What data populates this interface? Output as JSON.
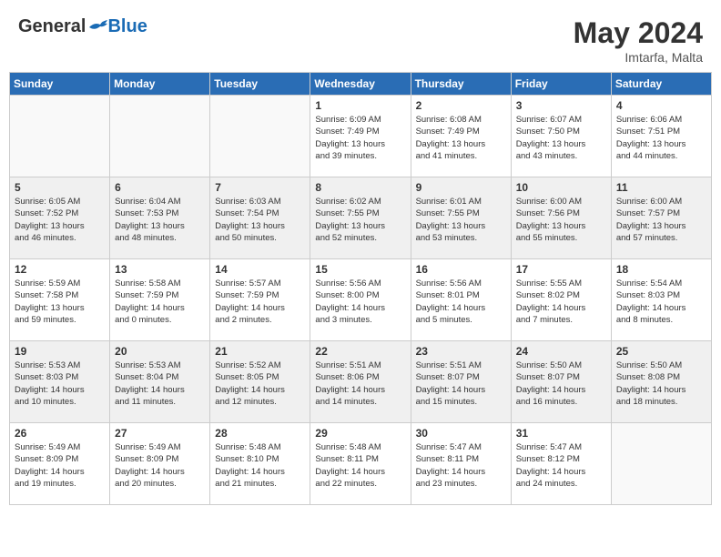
{
  "header": {
    "logo_general": "General",
    "logo_blue": "Blue",
    "month_year": "May 2024",
    "location": "Imtarfa, Malta"
  },
  "days_of_week": [
    "Sunday",
    "Monday",
    "Tuesday",
    "Wednesday",
    "Thursday",
    "Friday",
    "Saturday"
  ],
  "weeks": [
    [
      {
        "day": "",
        "content": ""
      },
      {
        "day": "",
        "content": ""
      },
      {
        "day": "",
        "content": ""
      },
      {
        "day": "1",
        "content": "Sunrise: 6:09 AM\nSunset: 7:49 PM\nDaylight: 13 hours\nand 39 minutes."
      },
      {
        "day": "2",
        "content": "Sunrise: 6:08 AM\nSunset: 7:49 PM\nDaylight: 13 hours\nand 41 minutes."
      },
      {
        "day": "3",
        "content": "Sunrise: 6:07 AM\nSunset: 7:50 PM\nDaylight: 13 hours\nand 43 minutes."
      },
      {
        "day": "4",
        "content": "Sunrise: 6:06 AM\nSunset: 7:51 PM\nDaylight: 13 hours\nand 44 minutes."
      }
    ],
    [
      {
        "day": "5",
        "content": "Sunrise: 6:05 AM\nSunset: 7:52 PM\nDaylight: 13 hours\nand 46 minutes."
      },
      {
        "day": "6",
        "content": "Sunrise: 6:04 AM\nSunset: 7:53 PM\nDaylight: 13 hours\nand 48 minutes."
      },
      {
        "day": "7",
        "content": "Sunrise: 6:03 AM\nSunset: 7:54 PM\nDaylight: 13 hours\nand 50 minutes."
      },
      {
        "day": "8",
        "content": "Sunrise: 6:02 AM\nSunset: 7:55 PM\nDaylight: 13 hours\nand 52 minutes."
      },
      {
        "day": "9",
        "content": "Sunrise: 6:01 AM\nSunset: 7:55 PM\nDaylight: 13 hours\nand 53 minutes."
      },
      {
        "day": "10",
        "content": "Sunrise: 6:00 AM\nSunset: 7:56 PM\nDaylight: 13 hours\nand 55 minutes."
      },
      {
        "day": "11",
        "content": "Sunrise: 6:00 AM\nSunset: 7:57 PM\nDaylight: 13 hours\nand 57 minutes."
      }
    ],
    [
      {
        "day": "12",
        "content": "Sunrise: 5:59 AM\nSunset: 7:58 PM\nDaylight: 13 hours\nand 59 minutes."
      },
      {
        "day": "13",
        "content": "Sunrise: 5:58 AM\nSunset: 7:59 PM\nDaylight: 14 hours\nand 0 minutes."
      },
      {
        "day": "14",
        "content": "Sunrise: 5:57 AM\nSunset: 7:59 PM\nDaylight: 14 hours\nand 2 minutes."
      },
      {
        "day": "15",
        "content": "Sunrise: 5:56 AM\nSunset: 8:00 PM\nDaylight: 14 hours\nand 3 minutes."
      },
      {
        "day": "16",
        "content": "Sunrise: 5:56 AM\nSunset: 8:01 PM\nDaylight: 14 hours\nand 5 minutes."
      },
      {
        "day": "17",
        "content": "Sunrise: 5:55 AM\nSunset: 8:02 PM\nDaylight: 14 hours\nand 7 minutes."
      },
      {
        "day": "18",
        "content": "Sunrise: 5:54 AM\nSunset: 8:03 PM\nDaylight: 14 hours\nand 8 minutes."
      }
    ],
    [
      {
        "day": "19",
        "content": "Sunrise: 5:53 AM\nSunset: 8:03 PM\nDaylight: 14 hours\nand 10 minutes."
      },
      {
        "day": "20",
        "content": "Sunrise: 5:53 AM\nSunset: 8:04 PM\nDaylight: 14 hours\nand 11 minutes."
      },
      {
        "day": "21",
        "content": "Sunrise: 5:52 AM\nSunset: 8:05 PM\nDaylight: 14 hours\nand 12 minutes."
      },
      {
        "day": "22",
        "content": "Sunrise: 5:51 AM\nSunset: 8:06 PM\nDaylight: 14 hours\nand 14 minutes."
      },
      {
        "day": "23",
        "content": "Sunrise: 5:51 AM\nSunset: 8:07 PM\nDaylight: 14 hours\nand 15 minutes."
      },
      {
        "day": "24",
        "content": "Sunrise: 5:50 AM\nSunset: 8:07 PM\nDaylight: 14 hours\nand 16 minutes."
      },
      {
        "day": "25",
        "content": "Sunrise: 5:50 AM\nSunset: 8:08 PM\nDaylight: 14 hours\nand 18 minutes."
      }
    ],
    [
      {
        "day": "26",
        "content": "Sunrise: 5:49 AM\nSunset: 8:09 PM\nDaylight: 14 hours\nand 19 minutes."
      },
      {
        "day": "27",
        "content": "Sunrise: 5:49 AM\nSunset: 8:09 PM\nDaylight: 14 hours\nand 20 minutes."
      },
      {
        "day": "28",
        "content": "Sunrise: 5:48 AM\nSunset: 8:10 PM\nDaylight: 14 hours\nand 21 minutes."
      },
      {
        "day": "29",
        "content": "Sunrise: 5:48 AM\nSunset: 8:11 PM\nDaylight: 14 hours\nand 22 minutes."
      },
      {
        "day": "30",
        "content": "Sunrise: 5:47 AM\nSunset: 8:11 PM\nDaylight: 14 hours\nand 23 minutes."
      },
      {
        "day": "31",
        "content": "Sunrise: 5:47 AM\nSunset: 8:12 PM\nDaylight: 14 hours\nand 24 minutes."
      },
      {
        "day": "",
        "content": ""
      }
    ]
  ]
}
